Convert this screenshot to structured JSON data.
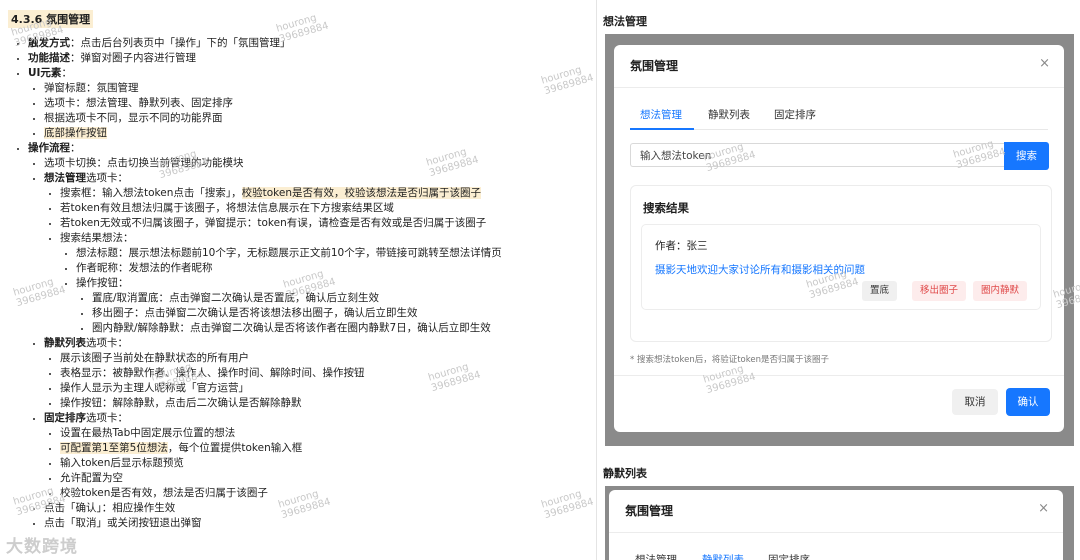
{
  "doc": {
    "heading": "4.3.6 氛围管理",
    "trigger": {
      "label": "触发方式",
      "text": "：点击后台列表页中「操作」下的「氛围管理」"
    },
    "desc": {
      "label": "功能描述",
      "text": "：弹窗对圈子内容进行管理"
    },
    "ui": {
      "label": "UI元素",
      "text": "：",
      "items": [
        "弹窗标题：氛围管理",
        "选项卡：想法管理、静默列表、固定排序",
        "根据选项卡不同，显示不同的功能界面",
        "底部操作按钮"
      ]
    },
    "flow": {
      "label": "操作流程",
      "text": "：",
      "tab_switch": "选项卡切换：点击切换当前管理的功能模块",
      "idea": {
        "label": "想法管理",
        "suffix": "选项卡：",
        "search_a": "搜索框：输入想法token点击「搜索」，",
        "search_b": "校验token是否有效，校验该想法是否归属于该圈子",
        "valid": "若token有效且想法归属于该圈子，将想法信息展示在下方搜索结果区域",
        "invalid": "若token无效或不归属该圈子，弹窗提示：token有误，请检查是否有效或是否归属于该圈子",
        "result": "搜索结果想法：",
        "result_items": [
          "想法标题：展示想法标题前10个字，无标题展示正文前10个字，带链接可跳转至想法详情页",
          "作者昵称：发想法的作者昵称"
        ],
        "buttons": "操作按钮：",
        "button_items": [
          "置底/取消置底：点击弹窗二次确认是否置底，确认后立刻生效",
          "移出圈子：点击弹窗二次确认是否将该想法移出圈子，确认后立即生效",
          "圈内静默/解除静默：点击弹窗二次确认是否将该作者在圈内静默7日，确认后立即生效"
        ]
      },
      "silent": {
        "label": "静默列表",
        "suffix": "选项卡：",
        "items": [
          "展示该圈子当前处在静默状态的所有用户",
          "表格显示：被静默作者、操作人、操作时间、解除时间、操作按钮",
          "操作人显示为主理人昵称或「官方运营」",
          "操作按钮：解除静默，点击后二次确认是否解除静默"
        ]
      },
      "fixed": {
        "label": "固定排序",
        "suffix": "选项卡：",
        "set": "设置在最热Tab中固定展示位置的想法",
        "config_a": "可配置第1至第5位想法",
        "config_b": "，每个位置提供token输入框",
        "items": [
          "输入token后显示标题预览",
          "允许配置为空",
          "校验token是否有效，想法是否归属于该圈子"
        ]
      },
      "confirm": "点击「确认」：相应操作生效",
      "cancel": "点击「取消」或关闭按钮退出弹窗"
    }
  },
  "watermark": {
    "line1": "hourong",
    "line2": "39689884"
  },
  "corner_logo": "大数跨境",
  "right": {
    "idea_section_title": "想法管理",
    "silent_section_title": "静默列表",
    "modal": {
      "title": "氛围管理",
      "close_icon": "×",
      "tabs": [
        "想法管理",
        "静默列表",
        "固定排序"
      ],
      "search_placeholder": "输入想法token",
      "search_button": "搜索",
      "results_title": "搜索结果",
      "author": "作者：张三",
      "idea_title": "摄影天地欢迎大家讨论所有和摄影相关的问题",
      "actions": [
        "置底",
        "移出圈子",
        "圈内静默"
      ],
      "note": "* 搜索想法token后，将验证token是否归属于该圈子",
      "cancel": "取消",
      "ok": "确认"
    }
  },
  "colors": {
    "accent": "#1677ff",
    "danger": "#e04b4b",
    "highlight": "#fbeed2",
    "overlay": "#8a8a8a"
  }
}
